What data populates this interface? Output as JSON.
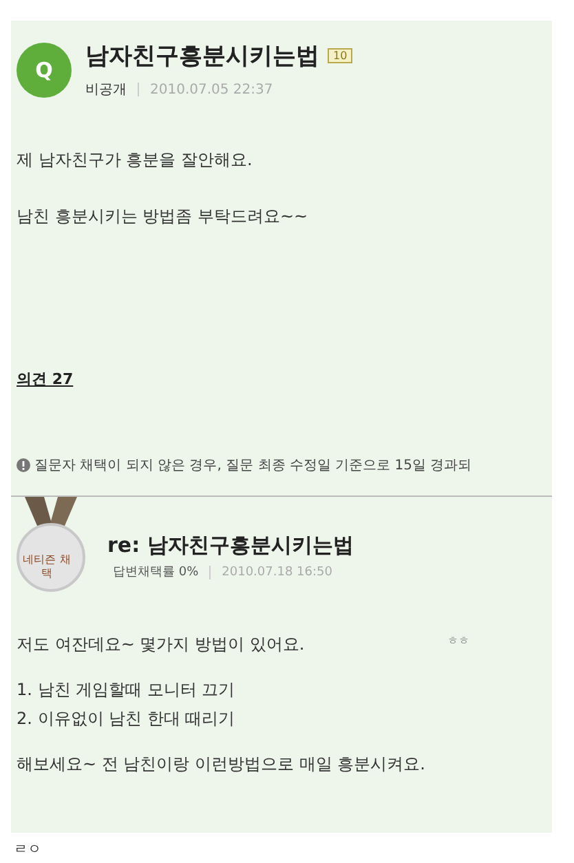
{
  "question": {
    "badge_letter": "Q",
    "title": "남자친구흥분시키는법",
    "points": "10",
    "author": "비공개",
    "date": "2010.07.05 22:37",
    "body": [
      "제 남자친구가 흥분을 잘안해요.",
      "남친 흥분시키는 방법좀 부탁드려요~~"
    ]
  },
  "opinions": "의견 27",
  "notice": "질문자 채택이 되지 않은 경우, 질문 최종 수정일 기준으로 15일 경과되",
  "answer": {
    "medal": "네티즌 채택",
    "title": "re: 남자친구흥분시키는법",
    "rate": "답변채택률 0%",
    "date": "2010.07.18 16:50",
    "side_note": "ㅎㅎ",
    "body": [
      [
        "저도 여잔데요~ 몇가지 방법이 있어요."
      ],
      [
        "1. 남친 게임할때 모니터 끄기",
        "2. 이유없이 남친 한대 때리기"
      ],
      [
        "해보세요~ 전 남친이랑 이런방법으로 매일 흥분시켜요."
      ]
    ]
  },
  "comment": "ㄹㅇ"
}
